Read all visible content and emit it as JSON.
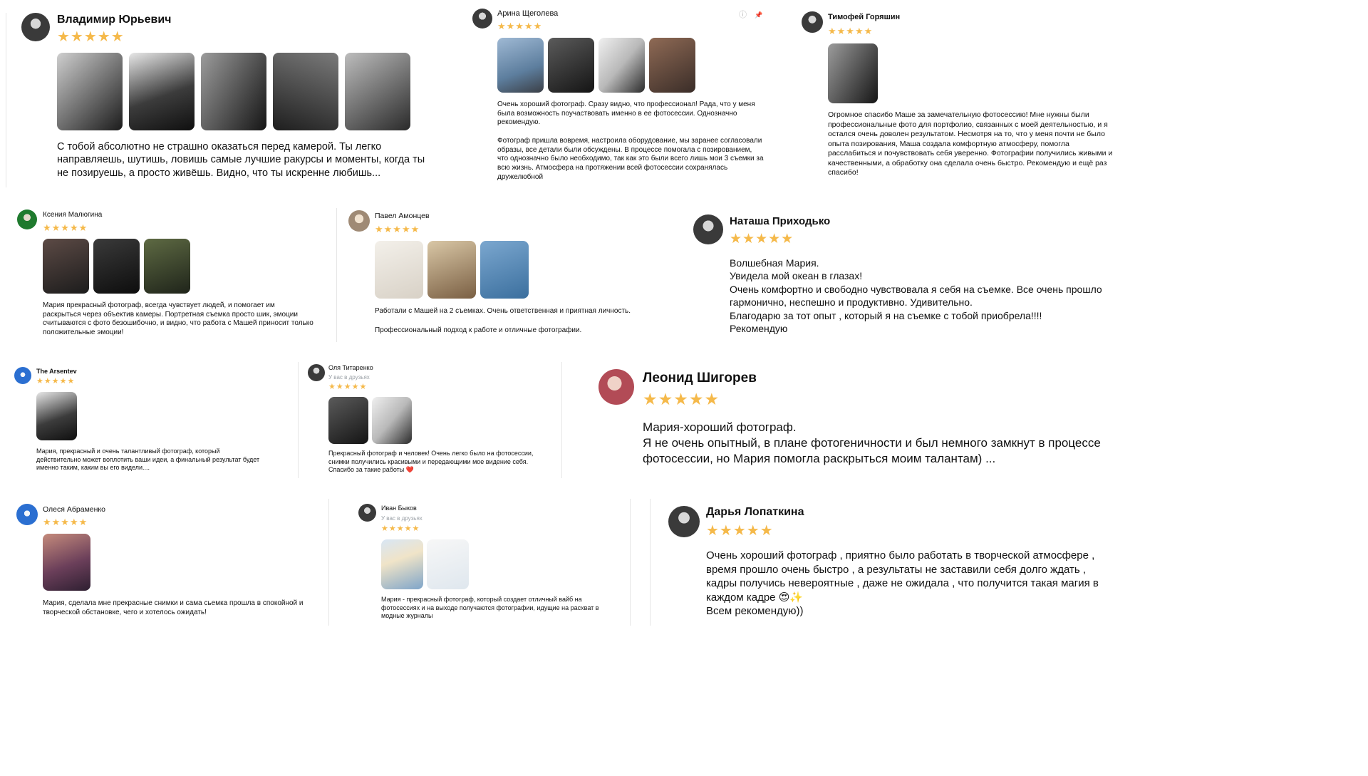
{
  "reviews": [
    {
      "name": "Владимир Юрьевич",
      "stars": "★★★★★",
      "text": "С тобой абсолютно не страшно оказаться перед камерой. Ты легко направляешь, шутишь, ловишь самые лучшие ракурсы и моменты, когда ты не позируешь, а просто живёшь. Видно, что ты искренне любишь..."
    },
    {
      "name": "Арина Щеголева",
      "stars": "★★★★★",
      "text_p1": "Очень хороший фотограф. Сразу видно, что профессионал! Рада, что у меня была возможность поучаствовать именно в ее фотосессии. Однозначно рекомендую.",
      "text_p2": "Фотограф пришла вовремя, настроила оборудование, мы заранее согласовали образы, все детали были обсуждены. В процессе помогала с позированием, что однозначно было необходимо, так как это были всего лишь мои 3 съемки за всю жизнь. Атмосфера на протяжении всей фотосессии сохранялась дружелюбной"
    },
    {
      "name": "Тимофей Горяшин",
      "stars": "★★★★★",
      "text": "Огромное спасибо Маше за замечательную фотосессию! Мне нужны были профессиональные фото для портфолио, связанных с моей деятельностью, и я остался очень доволен результатом. Несмотря на то, что у меня почти не было опыта позирования, Маша создала комфортную атмосферу, помогла расслабиться и почувствовать себя уверенно. Фотографии получились живыми и качественными, а обработку она сделала очень быстро. Рекомендую и ещё раз спасибо!"
    },
    {
      "name": "Ксения Малюгина",
      "stars": "★★★★★",
      "text": "Мария прекрасный фотограф, всегда чувствует людей, и помогает им раскрыться через объектив камеры. Портретная съемка просто шик, эмоции считываются с фото безошибочно, и видно, что работа с Машей приносит только положительные эмоции!"
    },
    {
      "name": "Павел Амонцев",
      "stars": "★★★★★",
      "text_p1": "Работали с Машей на 2 съемках. Очень ответственная и приятная личность.",
      "text_p2": "Профессиональный подход к работе и отличные фотографии."
    },
    {
      "name": "Наташа Приходько",
      "stars": "★★★★★",
      "lines": [
        "Волшебная Мария.",
        "Увидела мой океан в глазах!",
        "Очень комфортно и свободно чувствовала я себя на съемке. Все очень прошло гармонично, неспешно и продуктивно. Удивительно.",
        "Благодарю за тот опыт , который я на съемке с тобой приобрела!!!!",
        "Рекомендую"
      ]
    },
    {
      "name": "The Arsentev",
      "stars": "★★★★★",
      "text": "Мария, прекрасный и очень талантливый фотограф, который действительно может воплотить ваши идеи, а финальный результат будет именно таким, каким вы его видели...."
    },
    {
      "name": "Оля Титаренко",
      "subtitle": "У вас в друзьях",
      "stars": "★★★★★",
      "text": "Прекрасный фотограф и человек! Очень легко было на фотосессии, снимки получились красивыми и передающими мое видение себя. Спасибо за такие работы",
      "emoji": "❤️"
    },
    {
      "name": "Леонид Шигорев",
      "stars": "★★★★★",
      "lines": [
        "Мария-хороший фотограф.",
        "Я не очень опытный, в плане фотогеничности и был немного замкнут в процессе фотосессии, но Мария помогла раскрыться моим талантам) ..."
      ]
    },
    {
      "name": "Олеся Абраменко",
      "stars": "★★★★★",
      "text": "Мария, сделала мне прекрасные снимки и сама сьемка прошла в спокойной и творческой обстановке, чего и хотелось ожидать!"
    },
    {
      "name": "Иван Быков",
      "subtitle": "У вас в друзьях",
      "stars": "★★★★★",
      "text": "Мария - прекрасный фотограф, который создает отличный вайб на фотосессиях и на выходе получаются фотографии, идущие на расхват в модные журналы"
    },
    {
      "name": "Дарья Лопаткина",
      "stars": "★★★★★",
      "text": "Очень хороший фотограф , приятно было работать в творческой атмосфере , время прошло очень быстро , а результаты не заставили себя долго ждать , кадры получись невероятные , даже не ожидала , что получится такая магия в каждом кадре",
      "emoji": "😍✨",
      "last_line": "Всем рекомендую))"
    }
  ],
  "icons": {
    "info": "ⓘ",
    "pin": "📌"
  }
}
